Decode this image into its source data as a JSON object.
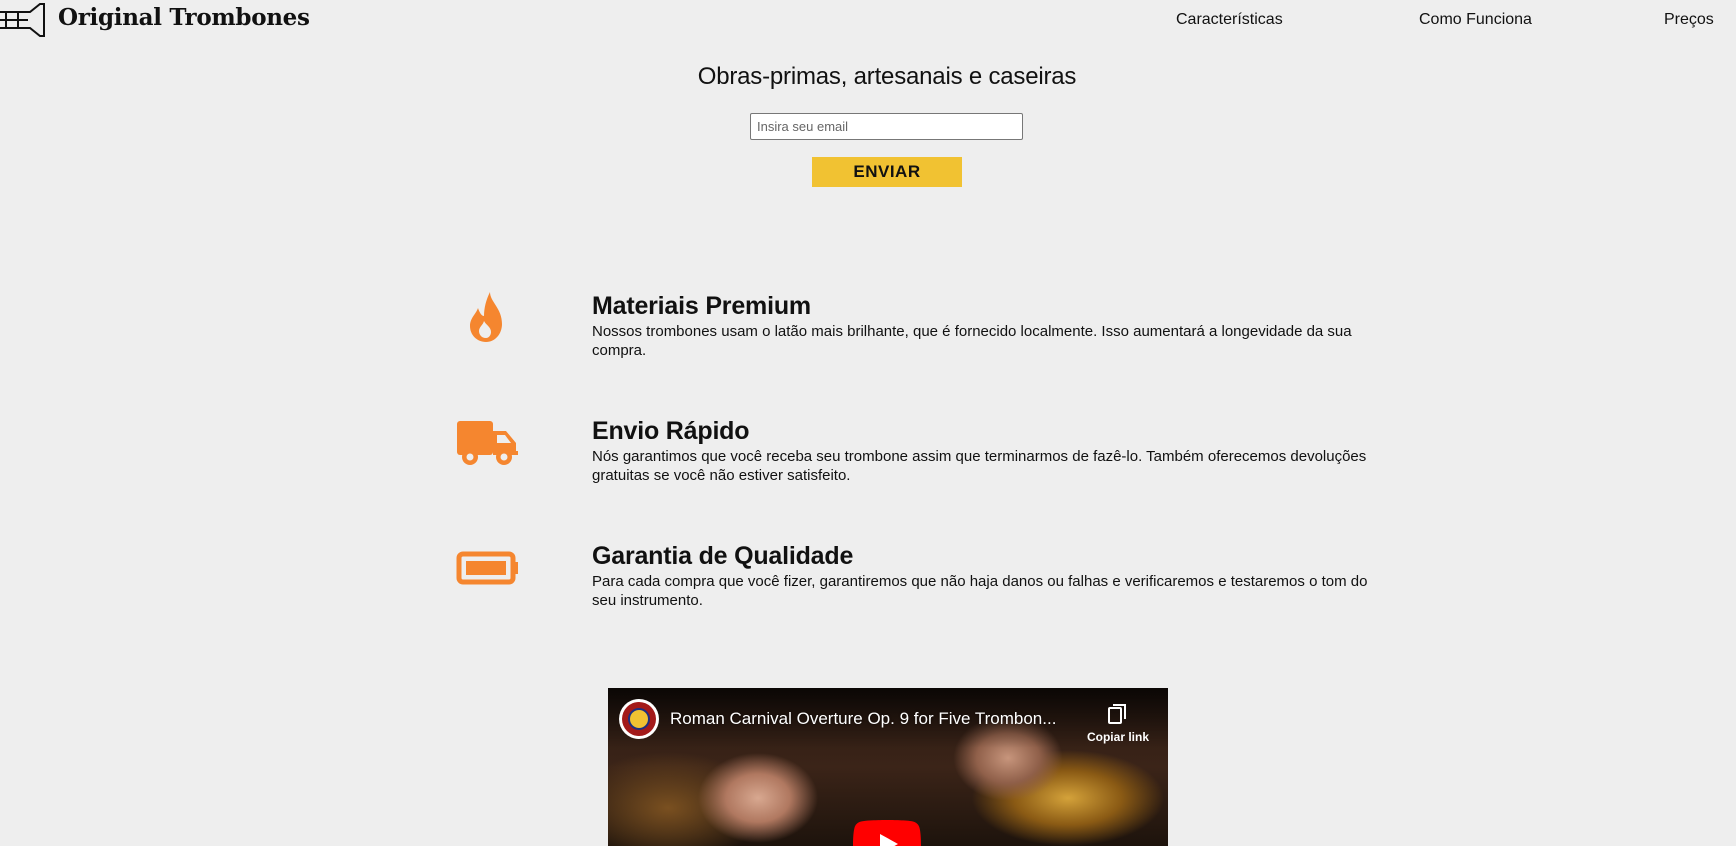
{
  "header": {
    "brand": "Original Trombones",
    "nav": [
      {
        "label": "Características"
      },
      {
        "label": "Como Funciona"
      },
      {
        "label": "Preços"
      }
    ]
  },
  "hero": {
    "title": "Obras-primas, artesanais e caseiras",
    "email_placeholder": "Insira seu email",
    "submit_label": "ENVIAR"
  },
  "features": [
    {
      "icon": "fire-icon",
      "title": "Materiais Premium",
      "description": "Nossos trombones usam o latão mais brilhante, que é fornecido localmente. Isso aumentará a longevidade da sua compra."
    },
    {
      "icon": "truck-icon",
      "title": "Envio Rápido",
      "description": "Nós garantimos que você receba seu trombone assim que terminarmos de fazê-lo. Também oferecemos devoluções gratuitas se você não estiver satisfeito."
    },
    {
      "icon": "battery-icon",
      "title": "Garantia de Qualidade",
      "description": "Para cada compra que você fizer, garantiremos que não haja danos ou falhas e verificaremos e testaremos o tom do seu instrumento."
    }
  ],
  "video": {
    "title": "Roman Carnival Overture Op. 9 for Five Trombon...",
    "copy_link_label": "Copiar link"
  },
  "colors": {
    "background": "#eeeeee",
    "accent_orange": "#f5862f",
    "button_yellow": "#f1c232",
    "youtube_red": "#ff0000"
  }
}
